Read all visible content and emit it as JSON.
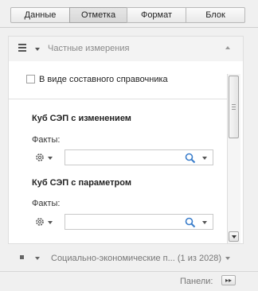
{
  "tabs": [
    {
      "label": "Данные",
      "active": false
    },
    {
      "label": "Отметка",
      "active": true
    },
    {
      "label": "Формат",
      "active": false
    },
    {
      "label": "Блок",
      "active": false
    }
  ],
  "panel": {
    "title": "Частные измерения",
    "checkbox_label": "В виде составного справочника",
    "checkbox_checked": false,
    "sections": [
      {
        "title": "Куб СЭП с изменением",
        "facts_label": "Факты:",
        "input_value": "",
        "icons": [
          "gear-icon",
          "search-icon",
          "chevron-down-icon"
        ]
      },
      {
        "title": "Куб СЭП с параметром",
        "facts_label": "Факты:",
        "input_value": "",
        "icons": [
          "gear-icon",
          "search-icon",
          "chevron-down-icon"
        ]
      }
    ]
  },
  "bottom_panel": {
    "title": "Социально-экономические п...",
    "count": "(1 из 2028)"
  },
  "footer": {
    "panels_label": "Панели:",
    "panels_button": "▸▸"
  },
  "colors": {
    "background": "#f0f0f0",
    "panel_body": "#ffffff",
    "search_icon": "#3b7ecb",
    "border": "#dedede"
  }
}
